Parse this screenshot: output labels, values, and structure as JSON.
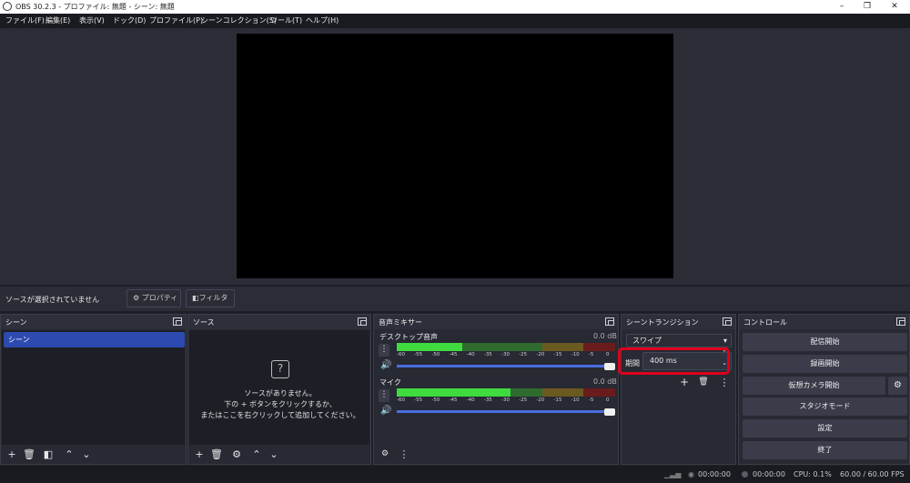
{
  "window": {
    "title": "OBS 30.2.3 - プロファイル: 無題 - シーン: 無題"
  },
  "menu": [
    "ファイル(F)",
    "編集(E)",
    "表示(V)",
    "ドック(D)",
    "プロファイル(P)",
    "シーンコレクション(S)",
    "ツール(T)",
    "ヘルプ(H)"
  ],
  "context": {
    "no_source": "ソースが選択されていません",
    "properties": "プロパティ",
    "filters": "フィルタ"
  },
  "scenes": {
    "title": "シーン",
    "items": [
      "シーン"
    ]
  },
  "sources": {
    "title": "ソース",
    "empty1": "ソースがありません。",
    "empty2": "下の + ボタンをクリックするか、",
    "empty3": "またはここを右クリックして追加してください。"
  },
  "mixer": {
    "title": "音声ミキサー",
    "ticks": [
      "-60",
      "-55",
      "-50",
      "-45",
      "-40",
      "-35",
      "-30",
      "-25",
      "-20",
      "-15",
      "-10",
      "-5",
      "0"
    ],
    "channels": [
      {
        "name": "デスクトップ音声",
        "db": "0.0 dB",
        "level": 0.3
      },
      {
        "name": "マイク",
        "db": "0.0 dB",
        "level": 0.52
      }
    ]
  },
  "transitions": {
    "title": "シーントランジション",
    "selected": "スワイプ",
    "duration_label": "期間",
    "duration_value": "400 ms"
  },
  "controls": {
    "title": "コントロール",
    "buttons": [
      "配信開始",
      "録画開始",
      "仮想カメラ開始",
      "スタジオモード",
      "設定",
      "終了"
    ]
  },
  "status": {
    "stream_time": "00:00:00",
    "rec_time": "00:00:00",
    "cpu": "CPU: 0.1%",
    "fps": "60.00 / 60.00 FPS"
  },
  "colors": {
    "highlight": "#e0001b",
    "accent": "#2d4ab0"
  }
}
